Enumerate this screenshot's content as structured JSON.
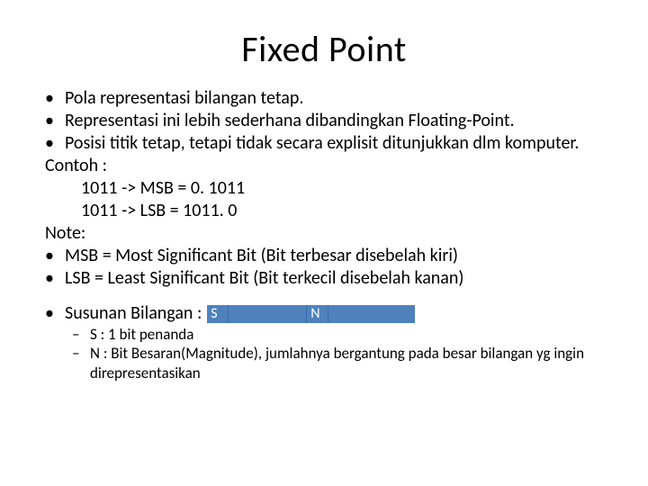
{
  "title": "Fixed Point",
  "b1": "Pola representasi bilangan tetap.",
  "b2": "Representasi ini lebih sederhana dibandingkan Floating-Point.",
  "b3": "Posisi titik tetap, tetapi tidak secara explisit ditunjukkan dlm komputer.",
  "contoh": "Contoh :",
  "ex1": "1011 -> MSB = 0. 1011",
  "ex2": "1011 -> LSB = 1011. 0",
  "note": "Note:",
  "b4": "MSB = Most Significant Bit (Bit terbesar disebelah kiri)",
  "b5": "LSB = Least Significant Bit (Bit terkecil disebelah kanan)",
  "susunan": "Susunan Bilangan :",
  "box_s": "S",
  "box_n": "N",
  "sub1": "S : 1 bit penanda",
  "sub2": "N : Bit Besaran(Magnitude), jumlahnya bergantung pada besar bilangan yg ingin direpresentasikan"
}
